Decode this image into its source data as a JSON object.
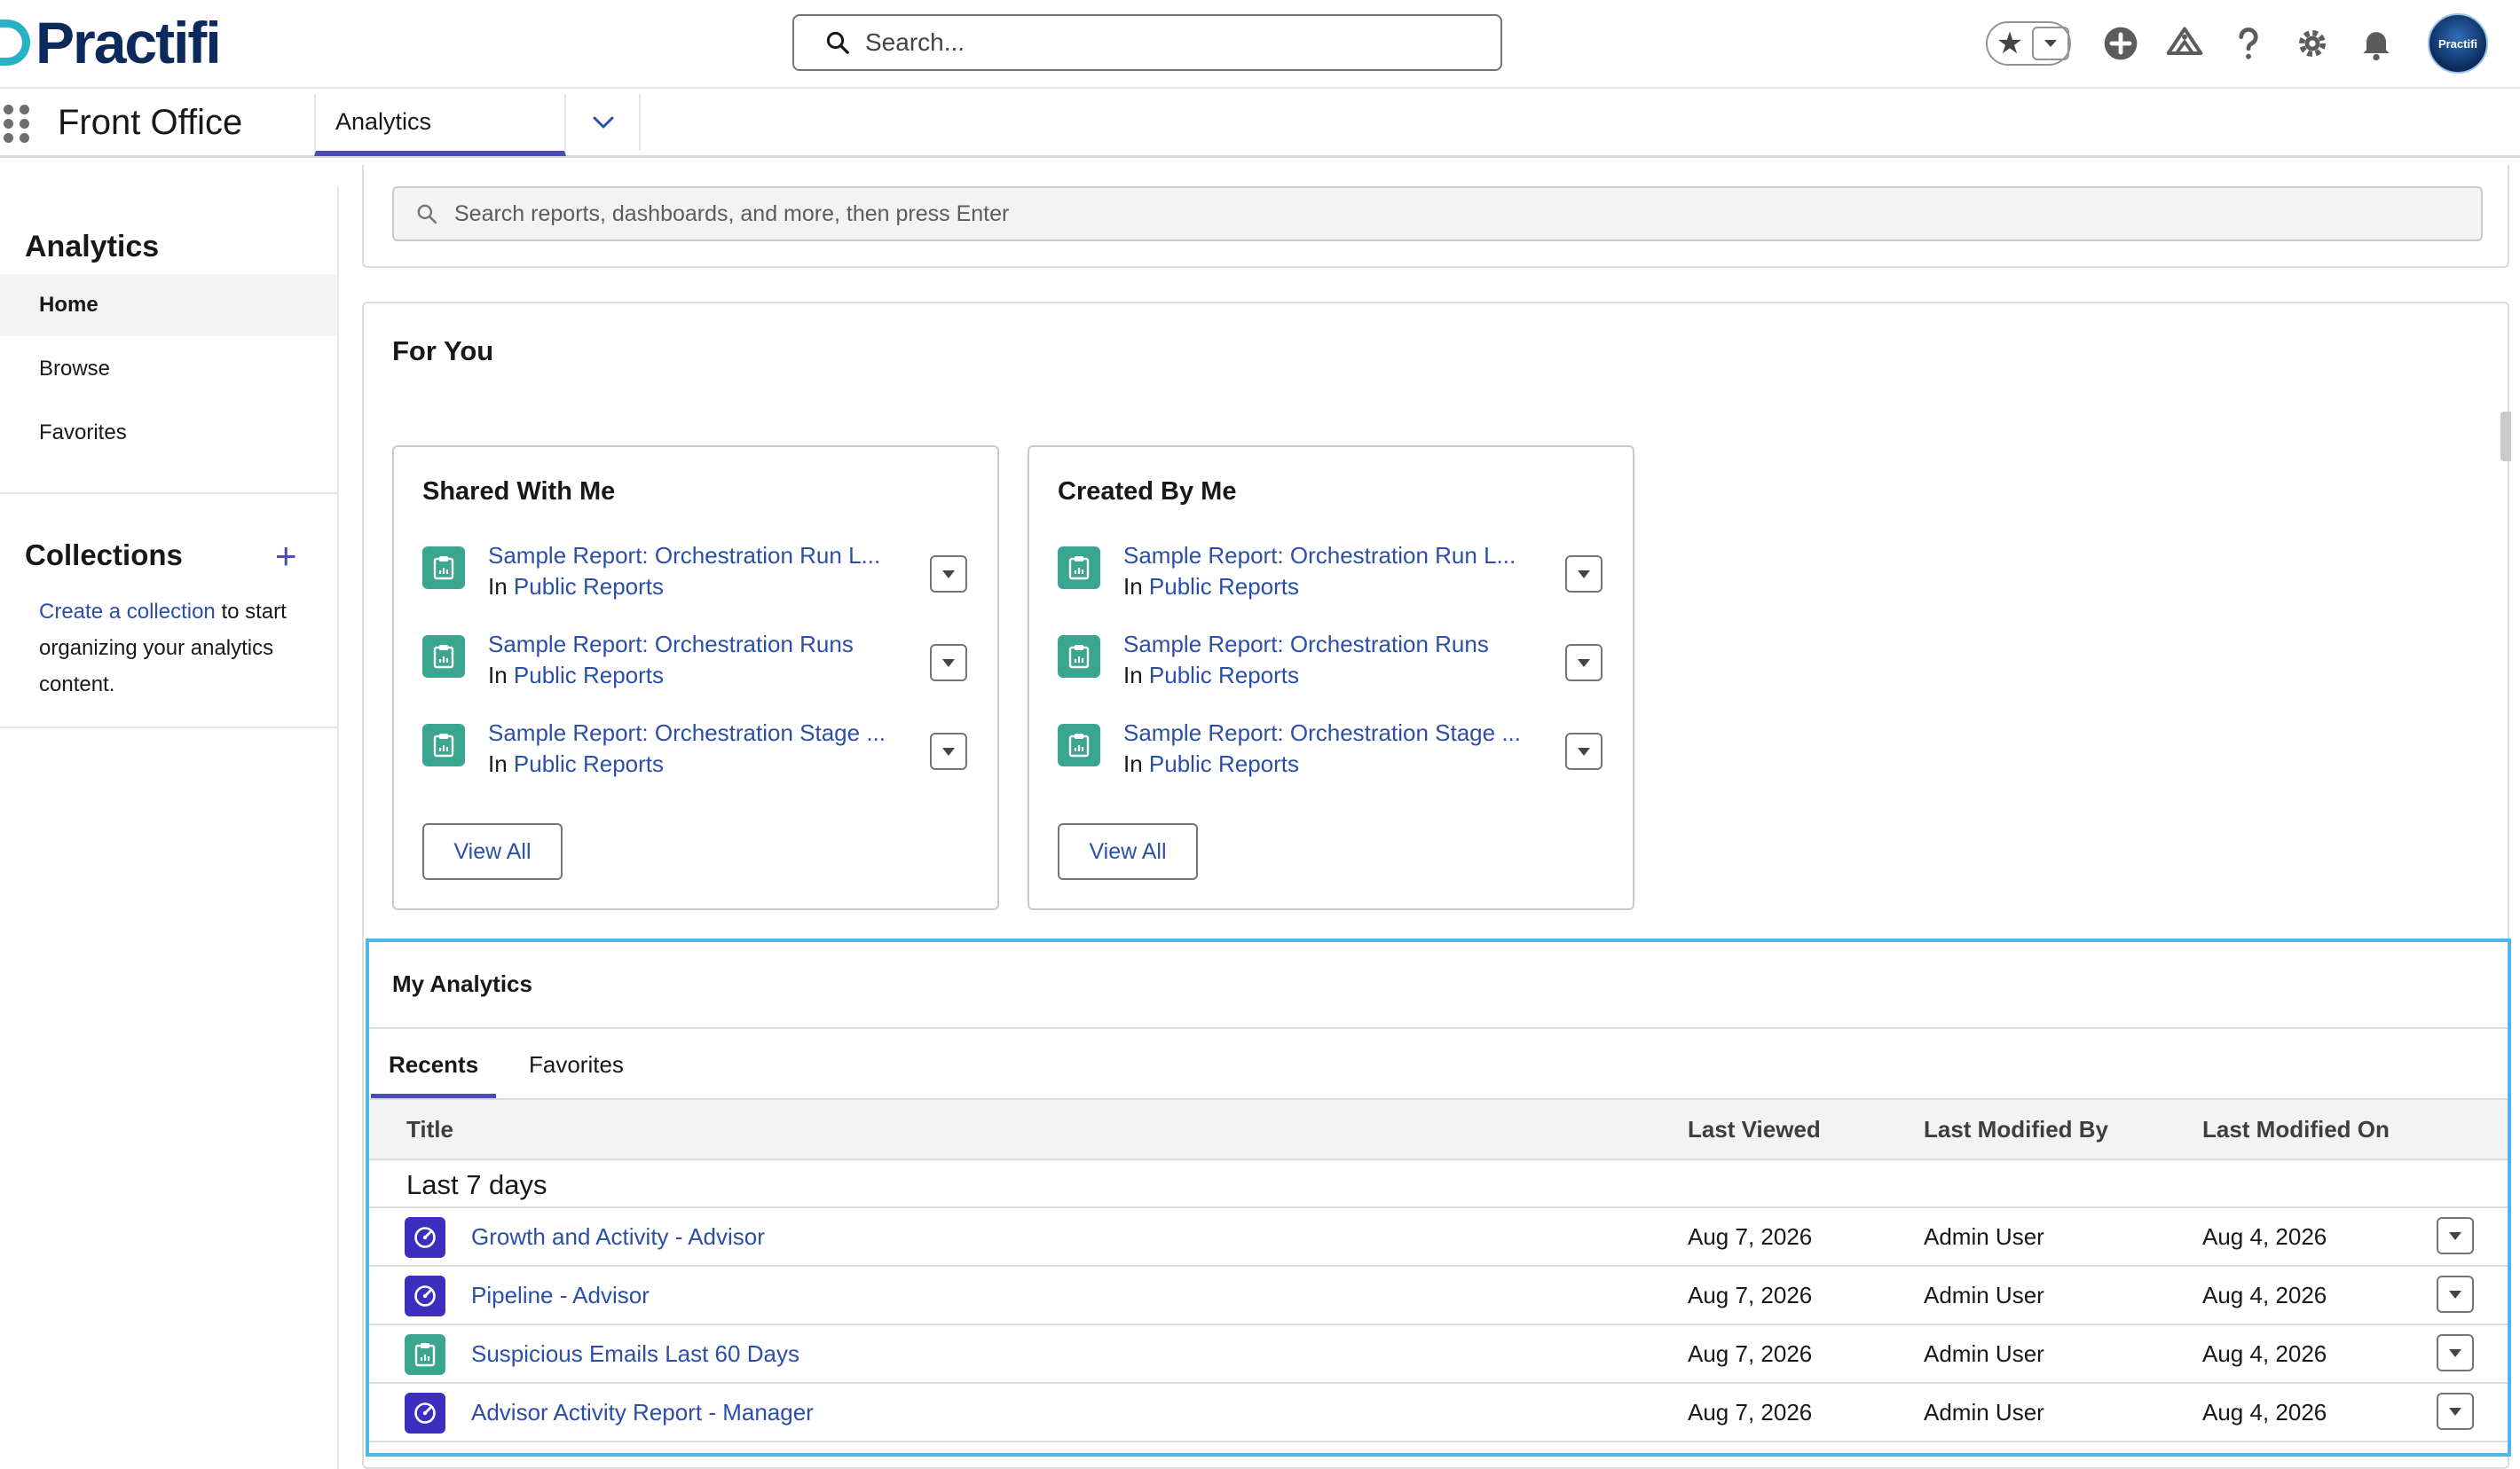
{
  "global_header": {
    "logo_text": "Practifi",
    "search_placeholder": "Search...",
    "avatar_text": "Practifi",
    "icons": [
      "star-icon",
      "chevron-down-icon",
      "add-icon",
      "trailhead-icon",
      "help-icon",
      "gear-icon",
      "bell-icon",
      "avatar"
    ]
  },
  "app_nav": {
    "app_name": "Front Office",
    "active_tab": "Analytics"
  },
  "sidebar": {
    "title": "Analytics",
    "items": [
      {
        "label": "Home",
        "active": true
      },
      {
        "label": "Browse",
        "active": false
      },
      {
        "label": "Favorites",
        "active": false
      }
    ],
    "collections": {
      "title": "Collections",
      "add_icon": "+",
      "help_link": "Create a collection",
      "help_rest_1": " to",
      "help_rest_2": "start organizing your analytics content."
    }
  },
  "report_search": {
    "placeholder": "Search reports, dashboards, and more, then press Enter"
  },
  "for_you": {
    "title": "For You",
    "shared_with_me": {
      "title": "Shared With Me",
      "items": [
        {
          "name": "Sample Report: Orchestration Run L...",
          "in_label": "In",
          "folder": "Public Reports"
        },
        {
          "name": "Sample Report: Orchestration Runs",
          "in_label": "In",
          "folder": "Public Reports"
        },
        {
          "name": "Sample Report: Orchestration Stage ...",
          "in_label": "In",
          "folder": "Public Reports"
        }
      ],
      "view_all": "View All"
    },
    "created_by_me": {
      "title": "Created By Me",
      "items": [
        {
          "name": "Sample Report: Orchestration Run L...",
          "in_label": "In",
          "folder": "Public Reports"
        },
        {
          "name": "Sample Report: Orchestration Runs",
          "in_label": "In",
          "folder": "Public Reports"
        },
        {
          "name": "Sample Report: Orchestration Stage ...",
          "in_label": "In",
          "folder": "Public Reports"
        }
      ],
      "view_all": "View All"
    }
  },
  "my_analytics": {
    "title": "My Analytics",
    "tabs": [
      {
        "label": "Recents",
        "active": true
      },
      {
        "label": "Favorites",
        "active": false
      }
    ],
    "columns": [
      "Title",
      "Last Viewed",
      "Last Modified By",
      "Last Modified On"
    ],
    "group_label": "Last 7 days",
    "rows": [
      {
        "type": "dashboard",
        "title": "Growth and Activity - Advisor",
        "last_viewed": "Aug 7, 2026",
        "modified_by": "Admin User",
        "modified_on": "Aug 4, 2026"
      },
      {
        "type": "dashboard",
        "title": "Pipeline - Advisor",
        "last_viewed": "Aug 7, 2026",
        "modified_by": "Admin User",
        "modified_on": "Aug 4, 2026"
      },
      {
        "type": "report",
        "title": "Suspicious Emails Last 60 Days",
        "last_viewed": "Aug 7, 2026",
        "modified_by": "Admin User",
        "modified_on": "Aug 4, 2026"
      },
      {
        "type": "dashboard",
        "title": "Advisor Activity Report - Manager",
        "last_viewed": "Aug 7, 2026",
        "modified_by": "Admin User",
        "modified_on": "Aug 4, 2026"
      }
    ]
  },
  "colors": {
    "accent": "#4a4db8",
    "link": "#2b4fa8",
    "report_icon": "#3aa68f",
    "dashboard_icon": "#3c2fc0",
    "highlight_border": "#4fb7e8",
    "logo_navy": "#0c2a5b",
    "logo_teal": "#27b3c4"
  }
}
